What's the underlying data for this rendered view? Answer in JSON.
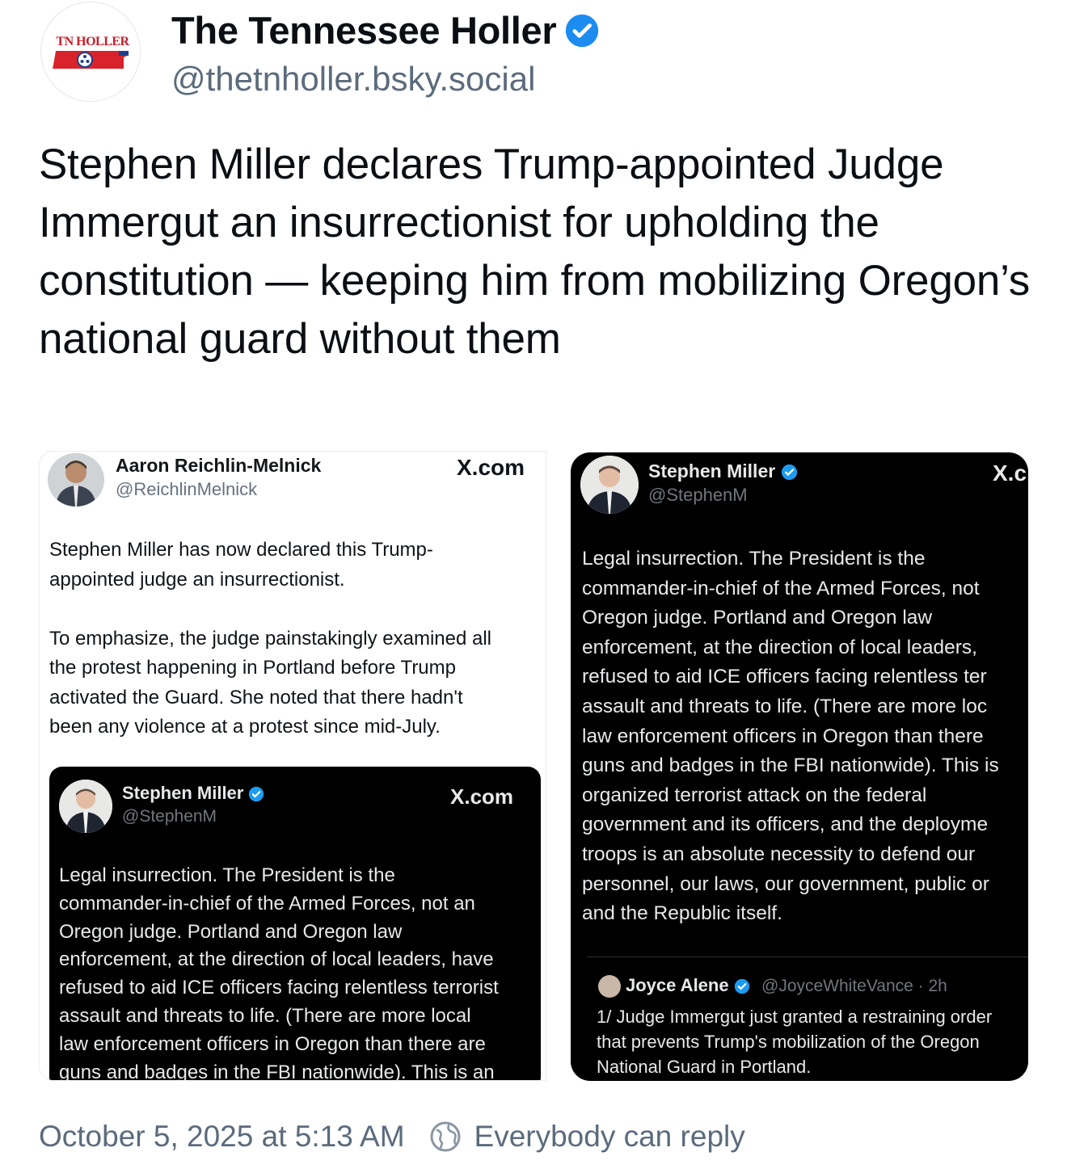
{
  "author": {
    "display_name": "The Tennessee Holler",
    "handle": "@thetnholler.bsky.social",
    "avatar_text": "TN HOLLER",
    "verified": true
  },
  "post": {
    "text": "Stephen Miller declares Trump-appointed Judge Immergut an insurrectionist for upholding the constitution — keeping him from mobilizing Oregon’s national guard without them"
  },
  "left_tweet": {
    "name": "Aaron Reichlin-Melnick",
    "handle": "@ReichlinMelnick",
    "source": "X.com",
    "body": "Stephen Miller has now declared this Trump-\nappointed judge an insurrectionist.\n\nTo emphasize, the judge painstakingly examined all\nthe protest happening in Portland before Trump\nactivated the Guard. She noted that there hadn't\nbeen any violence at a protest since mid-July.",
    "embedded": {
      "name": "Stephen Miller",
      "handle": "@StephenM",
      "source": "X.com",
      "body": "Legal insurrection. The President is the\ncommander-in-chief of the Armed Forces, not an\nOregon judge. Portland and Oregon law\nenforcement, at the direction of local leaders, have\nrefused to aid ICE officers facing relentless terrorist\nassault and threats to life. (There are more local\nlaw enforcement officers in Oregon than there are\nguns and badges in the FBI nationwide). This is an"
    }
  },
  "right_tweet": {
    "name": "Stephen Miller",
    "handle": "@StephenM",
    "source": "X.c",
    "body": "Legal insurrection. The President is the\ncommander-in-chief of the Armed Forces, not\nOregon judge. Portland and Oregon law\nenforcement, at the direction of local leaders,\nrefused to aid ICE officers facing relentless ter\nassault and threats to life. (There are more loc\nlaw enforcement officers in Oregon than there\nguns and badges in the FBI nationwide). This is\norganized terrorist attack on the federal\ngovernment and its officers, and the deployme\ntroops is an absolute necessity to defend our\npersonnel, our laws, our government, public or\nand the Republic itself.",
    "quote": {
      "name": "Joyce Alene",
      "handle": "@JoyceWhiteVance · 2h",
      "body": "1/ Judge Immergut just granted a restraining order\nthat prevents Trump's mobilization of the Oregon\nNational Guard in Portland."
    }
  },
  "footer": {
    "timestamp": "October 5, 2025 at 5:13 AM",
    "reply_setting": "Everybody can reply"
  },
  "colors": {
    "verified_blue": "#1d9bf0",
    "muted_text": "#5b6b7c",
    "brand_red": "#c81e2a"
  }
}
